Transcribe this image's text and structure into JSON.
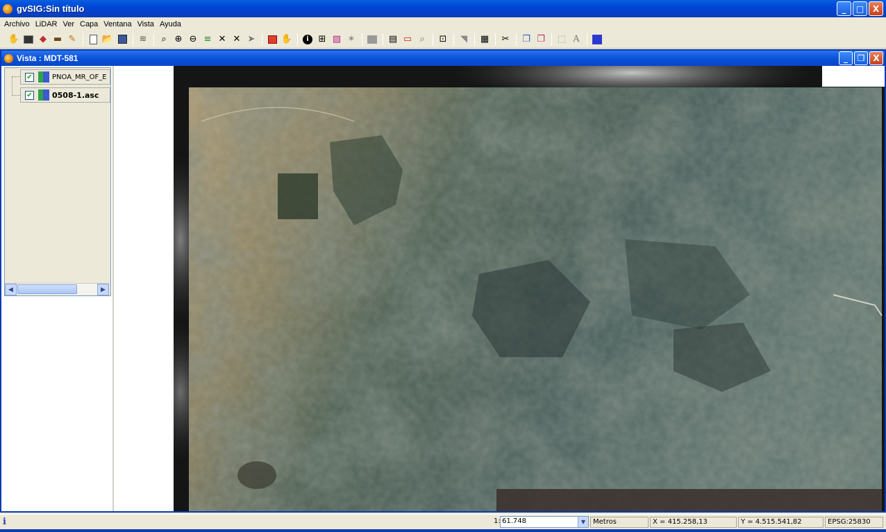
{
  "window": {
    "title": "gvSIG:Sin título",
    "buttons": [
      "_",
      "□",
      "X"
    ]
  },
  "menu": [
    "Archivo",
    "LiDAR",
    "Ver",
    "Capa",
    "Ventana",
    "Vista",
    "Ayuda"
  ],
  "toolbar_icons": [
    "hand-globe-icon",
    "terminal-icon",
    "layers-icon",
    "stack-icon",
    "paint-icon",
    "new-document-icon",
    "open-folder-icon",
    "save-icon",
    "layer-manager-icon",
    "zoom-select-icon",
    "zoom-in-icon",
    "zoom-out-icon",
    "full-extent-icon",
    "zoom-layer-icon",
    "zoom-expand-icon",
    "previous-zoom-icon",
    "add-layer-icon",
    "pan-hand-icon",
    "info-icon",
    "measure-icon",
    "area-icon",
    "star-tool-icon",
    "gray-box-icon",
    "table-icon",
    "rectangle-select-icon",
    "polygon-select-icon",
    "export-icon",
    "brush-icon",
    "grid-icon",
    "tools-icon",
    "copy-icon",
    "paste-icon",
    "dotted-select-icon",
    "text-icon",
    "plugin-icon"
  ],
  "view": {
    "title": "Vista : MDT-581",
    "layers": [
      {
        "name": "PNOA_MR_OF_E",
        "checked": true,
        "bold": false
      },
      {
        "name": "0508-1.asc",
        "checked": true,
        "bold": true
      }
    ]
  },
  "status": {
    "info_symbol": "i",
    "scale_prefix": "1:",
    "scale_value": "61.748",
    "units": "Metros",
    "x": "X = 415.258,13",
    "y": "Y = 4.515.541,82",
    "epsg": "EPSG:25830"
  },
  "colors": {
    "titlebar": "#0046d5",
    "chrome": "#ece9d8",
    "map_bg": "#141414"
  }
}
